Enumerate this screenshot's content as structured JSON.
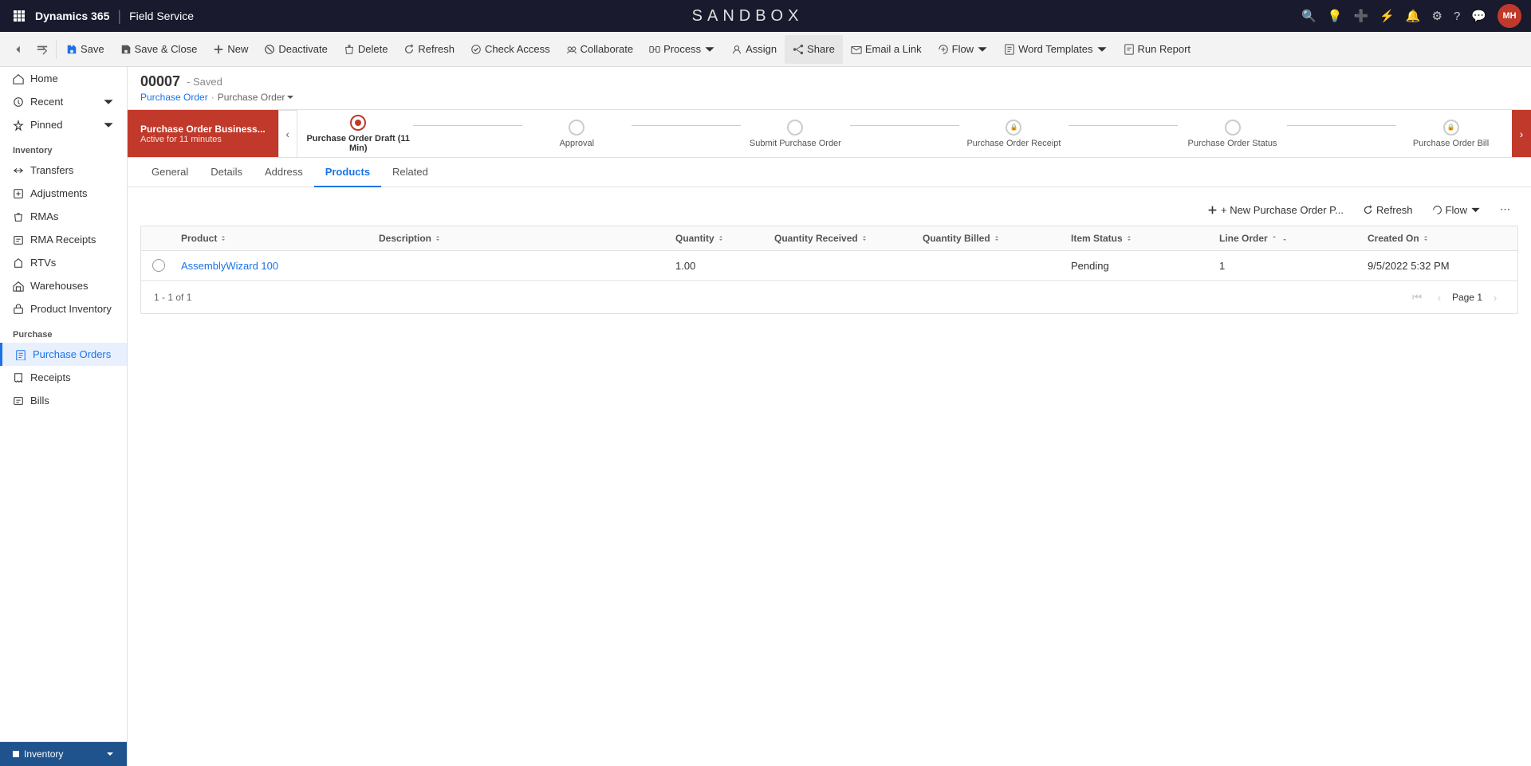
{
  "app": {
    "grid_label": "⊞",
    "brand": "Dynamics 365",
    "separator": "|",
    "module": "Field Service",
    "title": "SANDBOX",
    "avatar": "MH"
  },
  "commandbar": {
    "back_label": "←",
    "forward_label": "⇆",
    "save_label": "Save",
    "save_close_label": "Save & Close",
    "new_label": "New",
    "deactivate_label": "Deactivate",
    "delete_label": "Delete",
    "refresh_label": "Refresh",
    "check_access_label": "Check Access",
    "collaborate_label": "Collaborate",
    "process_label": "Process",
    "assign_label": "Assign",
    "share_label": "Share",
    "email_link_label": "Email a Link",
    "flow_label": "Flow",
    "word_templates_label": "Word Templates",
    "run_report_label": "Run Report"
  },
  "sidebar": {
    "home_label": "Home",
    "recent_label": "Recent",
    "pinned_label": "Pinned",
    "inventory_section": "Inventory",
    "transfers_label": "Transfers",
    "adjustments_label": "Adjustments",
    "rmas_label": "RMAs",
    "rma_receipts_label": "RMA Receipts",
    "rtvs_label": "RTVs",
    "warehouses_label": "Warehouses",
    "product_inventory_label": "Product Inventory",
    "purchase_section": "Purchase",
    "purchase_orders_label": "Purchase Orders",
    "receipts_label": "Receipts",
    "bills_label": "Bills",
    "bottom_label": "Inventory"
  },
  "record": {
    "id": "00007",
    "status": "- Saved",
    "breadcrumb_part1": "Purchase Order",
    "breadcrumb_sep": "·",
    "breadcrumb_part2": "Purchase Order"
  },
  "process": {
    "active_stage_name": "Purchase Order Business...",
    "active_stage_sub": "Active for 11 minutes",
    "stages": [
      {
        "label": "Purchase Order Draft  (11 Min)",
        "active": true,
        "locked": false
      },
      {
        "label": "Approval",
        "active": false,
        "locked": false
      },
      {
        "label": "Submit Purchase Order",
        "active": false,
        "locked": false
      },
      {
        "label": "Purchase Order Receipt",
        "active": false,
        "locked": true
      },
      {
        "label": "Purchase Order Status",
        "active": false,
        "locked": false
      },
      {
        "label": "Purchase Order Bill",
        "active": false,
        "locked": true
      }
    ]
  },
  "tabs": [
    {
      "label": "General",
      "active": false
    },
    {
      "label": "Details",
      "active": false
    },
    {
      "label": "Address",
      "active": false
    },
    {
      "label": "Products",
      "active": true
    },
    {
      "label": "Related",
      "active": false
    }
  ],
  "products_grid": {
    "new_button": "+ New Purchase Order P...",
    "refresh_button": "Refresh",
    "flow_button": "Flow",
    "more_button": "⋯",
    "columns": [
      {
        "label": ""
      },
      {
        "label": "Product",
        "sortable": true
      },
      {
        "label": "Description",
        "sortable": true
      },
      {
        "label": "Quantity",
        "sortable": true
      },
      {
        "label": "Quantity Received",
        "sortable": true
      },
      {
        "label": "Quantity Billed",
        "sortable": true
      },
      {
        "label": "Item Status",
        "sortable": true
      },
      {
        "label": "Line Order",
        "sortable": true
      },
      {
        "label": "Created On",
        "sortable": true
      }
    ],
    "rows": [
      {
        "product": "AssemblyWizard 100",
        "description": "",
        "quantity": "1.00",
        "quantity_received": "",
        "quantity_billed": "",
        "item_status": "Pending",
        "line_order": "1",
        "created_on": "9/5/2022 5:32 PM"
      }
    ],
    "pagination": {
      "count_label": "1 - 1 of 1",
      "page_label": "Page 1"
    }
  }
}
